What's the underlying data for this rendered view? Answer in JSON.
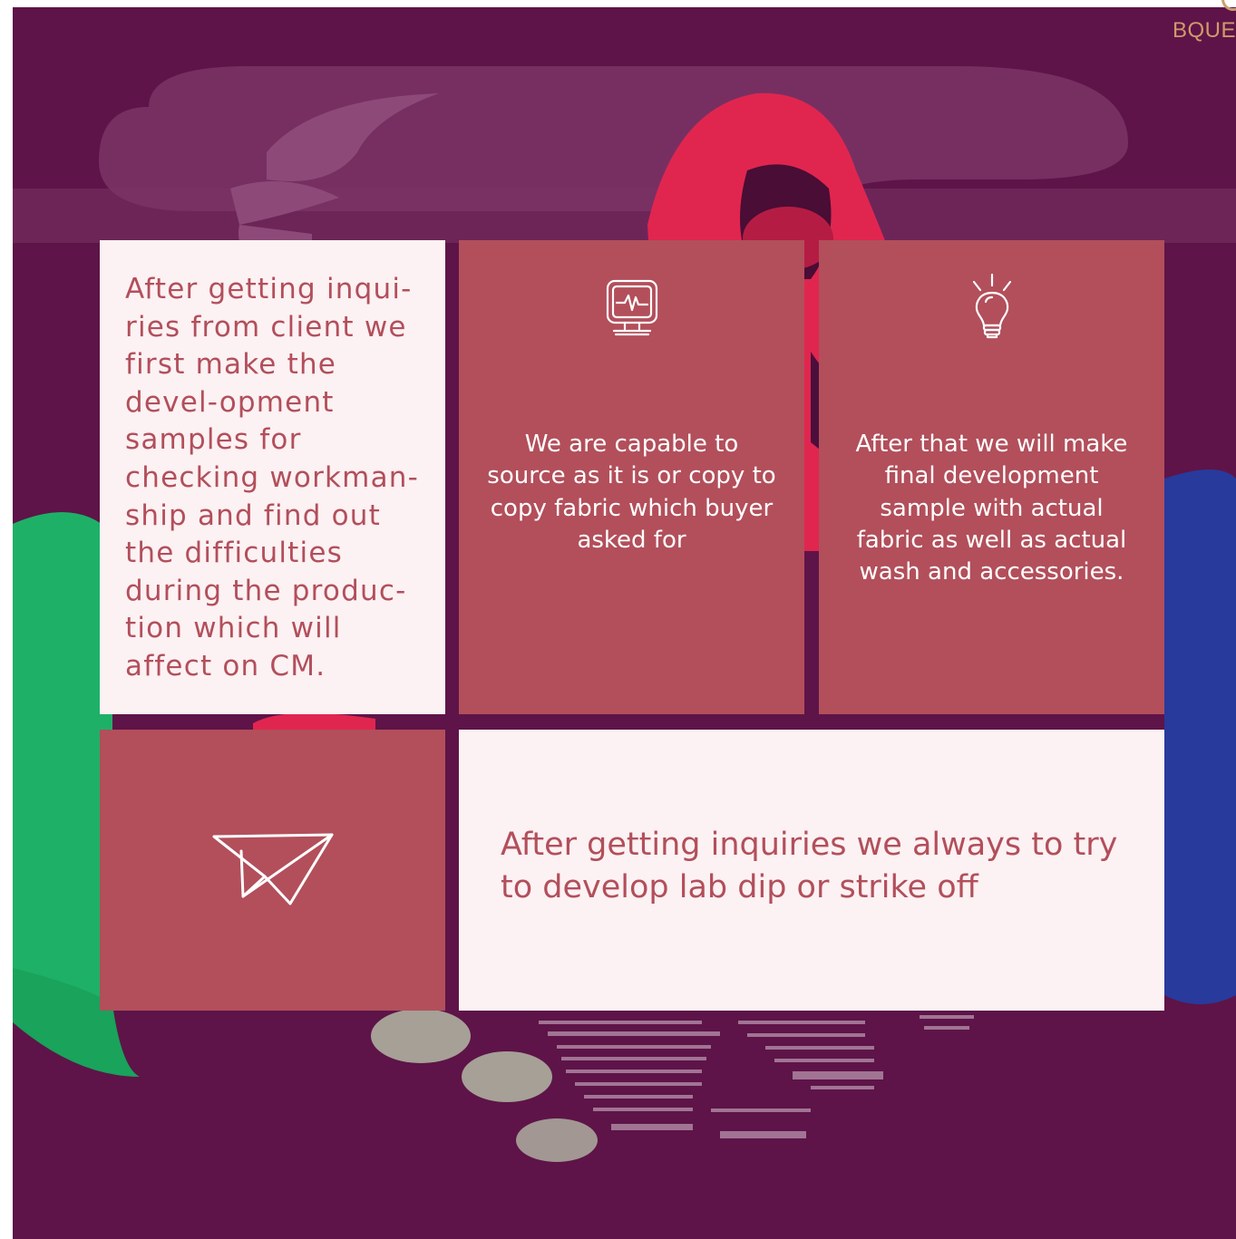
{
  "header": {
    "brand_text": "BQUE"
  },
  "cards": [
    {
      "text": "After getting inqui-ries from client we first make the devel-opment samples for checking workman-ship and find out the difficulties during the produc-tion which will affect on CM."
    },
    {
      "icon": "monitor-pulse-icon",
      "text": "We are capable to source as it is or copy to copy fabric which buyer asked for"
    },
    {
      "icon": "lightbulb-icon",
      "text": "After that we will make final development sample with actual fabric as well as actual wash and accessories."
    },
    {
      "icon": "paper-plane-icon"
    },
    {
      "text": "After getting inquiries we always to try to develop lab dip or strike off"
    }
  ],
  "colors": {
    "background": "#5e1448",
    "card_light": "#fcf1f3",
    "card_red": "#b24f5b",
    "accent_text": "#b24f5b",
    "brand_gold": "#d09a6a"
  }
}
